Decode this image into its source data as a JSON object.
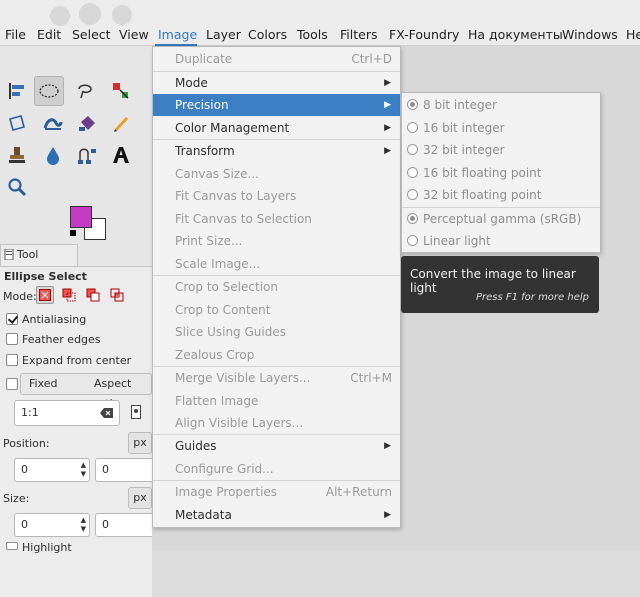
{
  "menubar": {
    "items": [
      "File",
      "Edit",
      "Select",
      "View",
      "Image",
      "Layer",
      "Colors",
      "Tools",
      "Filters",
      "FX-Foundry",
      "На документы",
      "Windows",
      "He"
    ],
    "active": "Image"
  },
  "toolbox": {
    "tools": [
      "align-icon",
      "ellipse-select-icon",
      "lasso-icon",
      "fuzzy-select-icon",
      "perspective-icon",
      "warp-icon",
      "paint-bucket-icon",
      "pencil-icon",
      "clone-stamp-icon",
      "smudge-icon",
      "path-icon",
      "text-icon",
      "zoom-icon"
    ],
    "fg_color": "#c43cc4",
    "bg_color": "#ffffff"
  },
  "tool_options": {
    "tab_label": "Tool Options",
    "title": "Ellipse Select",
    "mode_label": "Mode:",
    "antialiasing": {
      "label": "Antialiasing",
      "checked": true
    },
    "feather": {
      "label": "Feather edges",
      "checked": false
    },
    "expand": {
      "label": "Expand from center",
      "checked": false
    },
    "fixed": {
      "label": "Fixed",
      "checked": false,
      "aspect": "Aspect ratio"
    },
    "ratio_value": "1:1",
    "position_label": "Position:",
    "position_unit": "px",
    "pos_x": "0",
    "pos_y": "0",
    "size_label": "Size:",
    "size_unit": "px",
    "size_w": "0",
    "size_h": "0",
    "highlight": {
      "label": "Highlight",
      "checked": false
    }
  },
  "image_menu": {
    "items": [
      {
        "label": "Duplicate",
        "accel": "Ctrl+D",
        "disabled": true
      },
      {
        "label": "Mode",
        "submenu": true
      },
      {
        "label": "Precision",
        "submenu": true,
        "highlight": true
      },
      {
        "label": "Color Management",
        "submenu": true
      },
      {
        "label": "Transform",
        "submenu": true
      },
      {
        "label": "Canvas Size...",
        "disabled": true
      },
      {
        "label": "Fit Canvas to Layers",
        "disabled": true
      },
      {
        "label": "Fit Canvas to Selection",
        "disabled": true
      },
      {
        "label": "Print Size...",
        "disabled": true
      },
      {
        "label": "Scale Image...",
        "disabled": true
      },
      {
        "label": "Crop to Selection",
        "disabled": true
      },
      {
        "label": "Crop to Content",
        "disabled": true
      },
      {
        "label": "Slice Using Guides",
        "disabled": true
      },
      {
        "label": "Zealous Crop",
        "disabled": true
      },
      {
        "label": "Merge Visible Layers...",
        "accel": "Ctrl+M",
        "disabled": true
      },
      {
        "label": "Flatten Image",
        "disabled": true
      },
      {
        "label": "Align Visible Layers...",
        "disabled": true
      },
      {
        "label": "Guides",
        "submenu": true
      },
      {
        "label": "Configure Grid...",
        "disabled": true
      },
      {
        "label": "Image Properties",
        "accel": "Alt+Return",
        "disabled": true
      },
      {
        "label": "Metadata",
        "submenu": true
      }
    ]
  },
  "precision_menu": {
    "items": [
      {
        "label": "8 bit integer",
        "selected": true
      },
      {
        "label": "16 bit integer",
        "selected": false
      },
      {
        "label": "32 bit integer",
        "selected": false
      },
      {
        "label": "16 bit floating point",
        "selected": false
      },
      {
        "label": "32 bit floating point",
        "selected": false
      },
      {
        "label": "Perceptual gamma (sRGB)",
        "selected": true
      },
      {
        "label": "Linear light",
        "selected": false
      }
    ]
  },
  "tooltip": {
    "text": "Convert the image to linear light",
    "help": "Press F1 for more help"
  }
}
